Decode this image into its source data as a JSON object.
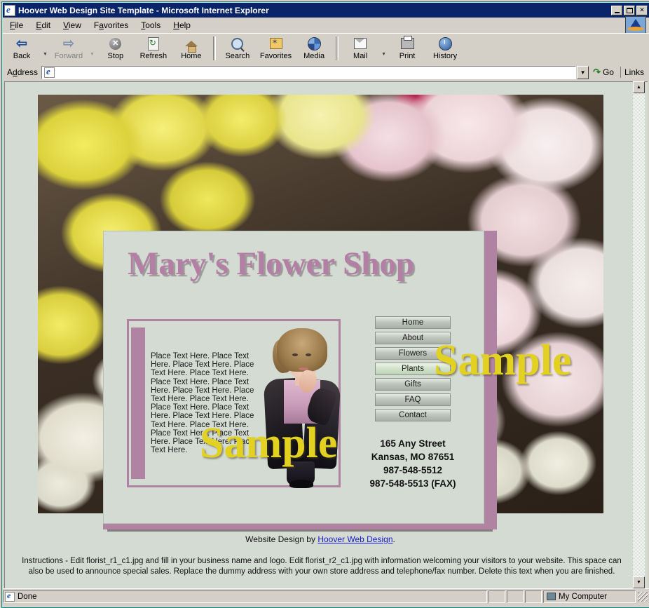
{
  "browser": {
    "title": "Hoover Web Design Site Template - Microsoft Internet Explorer",
    "window_controls": {
      "minimize": "_",
      "maximize": "□",
      "close": "✕"
    },
    "menu": [
      "File",
      "Edit",
      "View",
      "Favorites",
      "Tools",
      "Help"
    ],
    "toolbar": [
      {
        "label": "Back",
        "icon": "back-arrow-icon",
        "disabled": false,
        "has_caret": true
      },
      {
        "label": "Forward",
        "icon": "forward-arrow-icon",
        "disabled": true,
        "has_caret": true
      },
      {
        "label": "Stop",
        "icon": "stop-icon",
        "disabled": false,
        "has_caret": false
      },
      {
        "label": "Refresh",
        "icon": "refresh-icon",
        "disabled": false,
        "has_caret": false
      },
      {
        "label": "Home",
        "icon": "home-icon",
        "disabled": false,
        "has_caret": false
      },
      {
        "label": "Search",
        "icon": "search-icon",
        "disabled": false,
        "has_caret": false
      },
      {
        "label": "Favorites",
        "icon": "favorites-star-icon",
        "disabled": false,
        "has_caret": false
      },
      {
        "label": "Media",
        "icon": "media-icon",
        "disabled": false,
        "has_caret": false
      },
      {
        "label": "Mail",
        "icon": "mail-icon",
        "disabled": false,
        "has_caret": true
      },
      {
        "label": "Print",
        "icon": "printer-icon",
        "disabled": false,
        "has_caret": false
      },
      {
        "label": "History",
        "icon": "history-icon",
        "disabled": false,
        "has_caret": false
      }
    ],
    "address": {
      "label": "Address",
      "value": "",
      "placeholder": "",
      "go_label": "Go",
      "links_label": "Links"
    },
    "status": {
      "text": "Done",
      "zone": "My Computer"
    }
  },
  "page": {
    "shop_title": "Mary's Flower Shop",
    "body_text": "Place Text Here. Place Text Here. Place Text Here. Place Text Here. Place Text Here. Place Text Here. Place Text Here. Place Text Here. Place Text Here. Place Text Here. Place Text Here. Place Text Here. Place Text Here. Place Text Here. Place Text Here. Place Text Here. Place Text Here. Place Text Here. Place Text Here.",
    "nav": [
      {
        "label": "Home",
        "active": false
      },
      {
        "label": "About",
        "active": false
      },
      {
        "label": "Flowers",
        "active": false
      },
      {
        "label": "Plants",
        "active": true
      },
      {
        "label": "Gifts",
        "active": false
      },
      {
        "label": "FAQ",
        "active": false
      },
      {
        "label": "Contact",
        "active": false
      }
    ],
    "contact": {
      "street": "165 Any Street",
      "city_state_zip": "Kansas, MO 87651",
      "phone": "987-548-5512",
      "fax": "987-548-5513 (FAX)"
    },
    "watermark": "Sample",
    "credit": {
      "prefix": "Website Design by ",
      "link": "Hoover Web Design",
      "suffix": "."
    },
    "instructions": "Instructions - Edit florist_r1_c1.jpg and fill in your business name and logo. Edit florist_r2_c1.jpg with information welcoming your visitors to your website. This space can also be used to announce special sales. Replace the dummy address with your own store address and telephone/fax number. Delete this text when you are finished.",
    "colors": {
      "title_mauve": "#b37fa5",
      "panel_bg": "#d3dbd2",
      "page_bg": "#d4dbd3",
      "watermark_yellow": "#e2d121",
      "link_blue": "#1919c8",
      "nav_active_green": "#bcd4b4"
    }
  }
}
